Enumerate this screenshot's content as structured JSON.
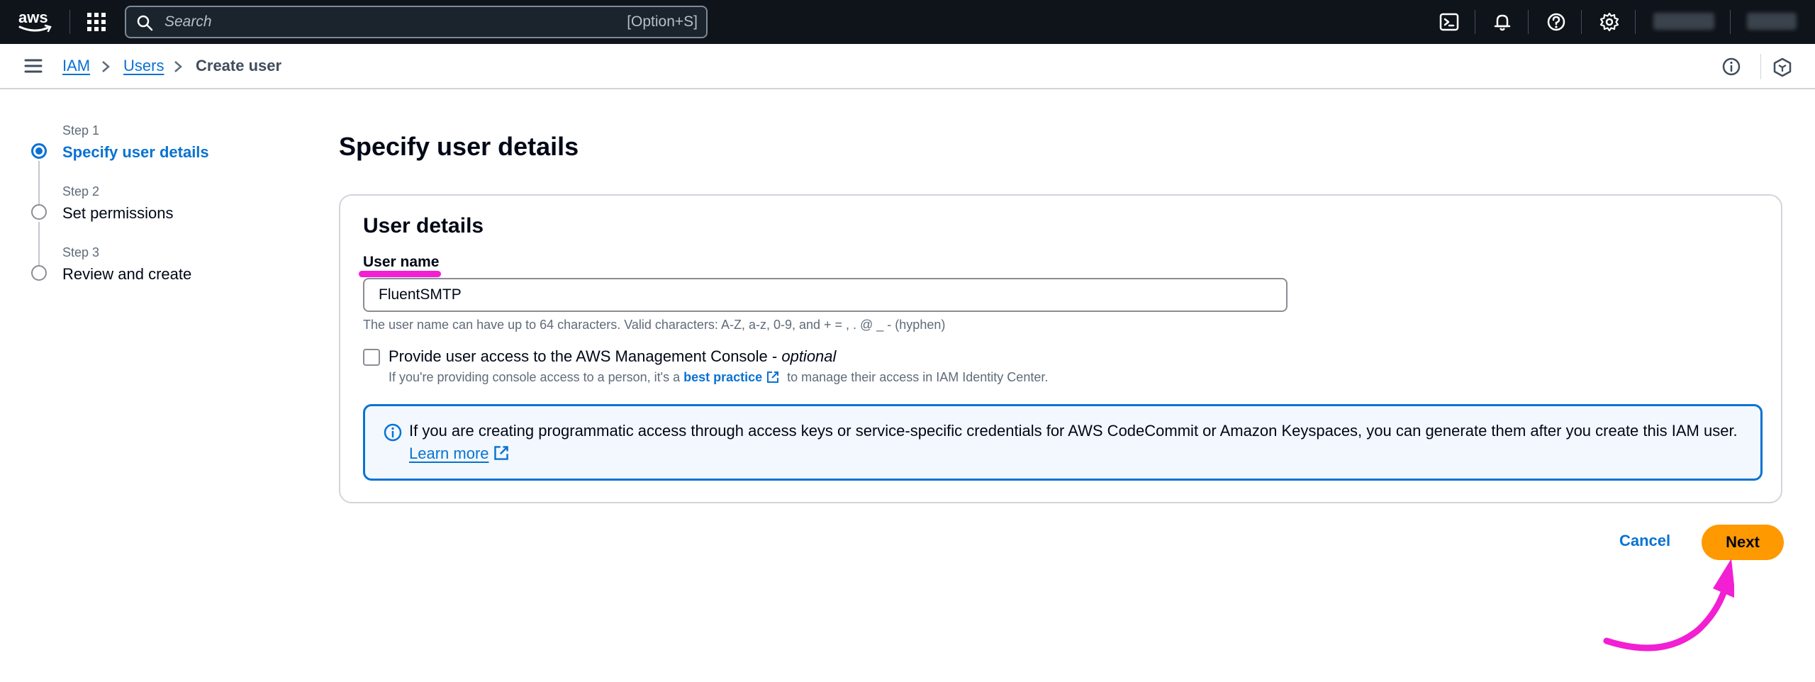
{
  "topbar": {
    "logo_text": "aws",
    "search_placeholder": "Search",
    "search_shortcut": "[Option+S]",
    "icons": [
      "cloudshell-icon",
      "bell-icon",
      "help-icon",
      "gear-icon"
    ]
  },
  "breadcrumb": {
    "items": [
      "IAM",
      "Users",
      "Create user"
    ]
  },
  "steps": [
    {
      "step": "Step 1",
      "title": "Specify user details",
      "active": true
    },
    {
      "step": "Step 2",
      "title": "Set permissions",
      "active": false
    },
    {
      "step": "Step 3",
      "title": "Review and create",
      "active": false
    }
  ],
  "page_title": "Specify user details",
  "card": {
    "title": "User details",
    "field_label": "User name",
    "field_value": "FluentSMTP",
    "hint": "The user name can have up to 64 characters. Valid characters: A-Z, a-z, 0-9, and + = , . @ _ - (hyphen)",
    "checkbox_label": "Provide user access to the AWS Management Console - ",
    "checkbox_label_optional": "optional",
    "checkbox_desc_before": "If you're providing console access to a person, it's a ",
    "checkbox_desc_link": "best practice",
    "checkbox_desc_after": " to manage their access in IAM Identity Center."
  },
  "alert": {
    "text": "If you are creating programmatic access through access keys or service-specific credentials for AWS CodeCommit or Amazon Keyspaces, you can generate them after you create this IAM user.",
    "link": "Learn more"
  },
  "actions": {
    "cancel": "Cancel",
    "next": "Next"
  },
  "colors": {
    "topbar_bg": "#0f141a",
    "link_blue": "#0972d3",
    "primary_orange": "#ff9900",
    "annotation_magenta": "#f21fd3"
  }
}
